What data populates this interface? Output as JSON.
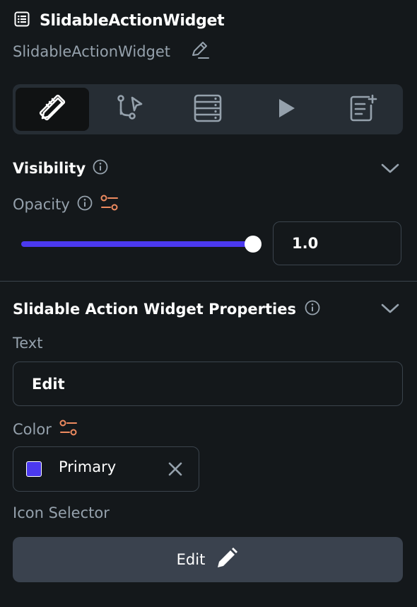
{
  "header": {
    "title": "SlidableActionWidget",
    "subtitle": "SlidableActionWidget"
  },
  "tabs": [
    {
      "icon": "design-ruler-icon",
      "active": true
    },
    {
      "icon": "action-flow-icon",
      "active": false
    },
    {
      "icon": "backend-query-icon",
      "active": false
    },
    {
      "icon": "play-icon",
      "active": false
    },
    {
      "icon": "add-note-icon",
      "active": false
    }
  ],
  "visibility": {
    "title": "Visibility",
    "opacity_label": "Opacity",
    "opacity_value": "1.0",
    "opacity_fraction": 1.0
  },
  "properties": {
    "title": "Slidable Action Widget Properties",
    "text_label": "Text",
    "text_value": "Edit",
    "color_label": "Color",
    "color_name": "Primary",
    "color_hex": "#4b39ef",
    "icon_selector_label": "Icon Selector",
    "icon_button_label": "Edit"
  },
  "colors": {
    "accent": "#4b39ef",
    "variable_icon": "#ee8b60",
    "background": "#14181b"
  }
}
